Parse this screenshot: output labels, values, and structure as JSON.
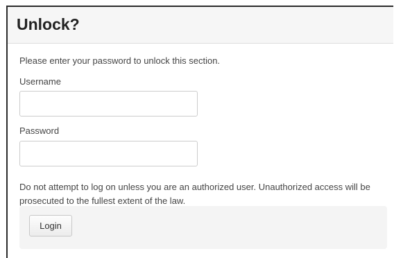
{
  "dialog": {
    "title": "Unlock?",
    "intro": "Please enter your password to unlock this section.",
    "username": {
      "label": "Username",
      "value": "",
      "placeholder": ""
    },
    "password": {
      "label": "Password",
      "value": "",
      "placeholder": ""
    },
    "warning": "Do not attempt to log on unless you are an authorized user. Unauthorized access will be prosecuted to the fullest extent of the law.",
    "login_label": "Login"
  },
  "colors": {
    "header_background": "#f6f6f6",
    "footer_background": "#f4f4f4",
    "text": "#444444",
    "title": "#222222"
  }
}
